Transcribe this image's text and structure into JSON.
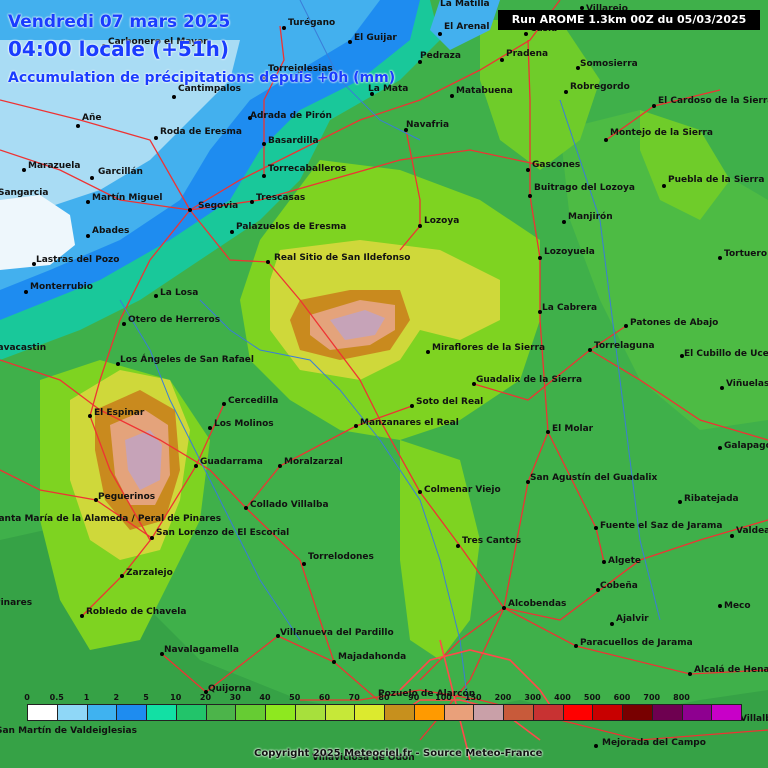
{
  "header": {
    "date_line": "Vendredi 07 mars 2025",
    "time_line": "04:00 locale (+51h)",
    "parameter_line": "Accumulation de précipitations depuis +0h (mm)",
    "run_info": "Run AROME 1.3km 00Z du 05/03/2025"
  },
  "colors": {
    "dry_white": "#ffffff",
    "very_light_blue": "#b9e3f6",
    "light_blue": "#43b0ee",
    "blue": "#1c72e8",
    "teal": "#1fd39a",
    "green": "#3fb04a",
    "lime": "#7ed321",
    "yellow": "#d6d936",
    "orange_brown": "#c98a1e",
    "salmon": "#e4a37b",
    "mauve": "#c6a3b8"
  },
  "scale": {
    "labels": [
      "0",
      "0.5",
      "1",
      "2",
      "5",
      "10",
      "20",
      "30",
      "40",
      "50",
      "60",
      "70",
      "80",
      "90",
      "100",
      "150",
      "200",
      "300",
      "400",
      "500",
      "600",
      "700",
      "800"
    ],
    "colors": [
      "#ffffff",
      "#8fd7f7",
      "#3fb2f0",
      "#1e8cf0",
      "#12e0a4",
      "#22c46a",
      "#4cb44a",
      "#66cc33",
      "#8ee81f",
      "#a7e03c",
      "#c6e838",
      "#dcea2e",
      "#c7901d",
      "#ff9a00",
      "#e9a07a",
      "#c9a0a8",
      "#c85a3a",
      "#c83232",
      "#ff0000",
      "#c80000",
      "#780000",
      "#6e0050",
      "#8e0090",
      "#c800c8"
    ]
  },
  "towns": [
    {
      "name": "Villarejo",
      "dot": [
        582,
        8
      ],
      "label": [
        586,
        4
      ]
    },
    {
      "name": "La Matilla",
      "dot": [
        0,
        0
      ],
      "label": [
        440,
        -1
      ]
    },
    {
      "name": "Turégano",
      "dot": [
        284,
        28
      ],
      "label": [
        288,
        18
      ]
    },
    {
      "name": "El Arenal",
      "dot": [
        440,
        34
      ],
      "label": [
        444,
        22
      ]
    },
    {
      "name": "Casla",
      "dot": [
        526,
        34
      ],
      "label": [
        530,
        24
      ]
    },
    {
      "name": "Cantimpalos",
      "dot": [
        174,
        97
      ],
      "label": [
        178,
        84
      ]
    },
    {
      "name": "Carbonero el Mayor",
      "dot": [
        104,
        46
      ],
      "label": [
        108,
        37
      ]
    },
    {
      "name": "El Guijar",
      "dot": [
        350,
        42
      ],
      "label": [
        354,
        33
      ]
    },
    {
      "name": "Pedraza",
      "dot": [
        420,
        62
      ],
      "label": [
        420,
        51
      ]
    },
    {
      "name": "Pradena",
      "dot": [
        502,
        60
      ],
      "label": [
        506,
        49
      ]
    },
    {
      "name": "Torreiglesias",
      "dot": [
        264,
        78
      ],
      "label": [
        268,
        64
      ]
    },
    {
      "name": "Somosierra",
      "dot": [
        578,
        68
      ],
      "label": [
        580,
        59
      ]
    },
    {
      "name": "La Mata",
      "dot": [
        372,
        94
      ],
      "label": [
        368,
        84
      ]
    },
    {
      "name": "Matabuena",
      "dot": [
        452,
        96
      ],
      "label": [
        456,
        86
      ]
    },
    {
      "name": "Robregordo",
      "dot": [
        566,
        92
      ],
      "label": [
        570,
        82
      ]
    },
    {
      "name": "El Cardoso de la Sierra",
      "dot": [
        654,
        106
      ],
      "label": [
        658,
        96
      ]
    },
    {
      "name": "Añe",
      "dot": [
        78,
        126
      ],
      "label": [
        82,
        113
      ]
    },
    {
      "name": "Adrada de Pirón",
      "dot": [
        250,
        118
      ],
      "label": [
        250,
        111
      ]
    },
    {
      "name": "Roda de Eresma",
      "dot": [
        156,
        138
      ],
      "label": [
        160,
        127
      ]
    },
    {
      "name": "Navafria",
      "dot": [
        406,
        130
      ],
      "label": [
        406,
        120
      ]
    },
    {
      "name": "Montejo de la Sierra",
      "dot": [
        606,
        140
      ],
      "label": [
        610,
        128
      ]
    },
    {
      "name": "Basardilla",
      "dot": [
        264,
        144
      ],
      "label": [
        268,
        136
      ]
    },
    {
      "name": "Marazuela",
      "dot": [
        24,
        170
      ],
      "label": [
        28,
        161
      ]
    },
    {
      "name": "Garcillán",
      "dot": [
        92,
        178
      ],
      "label": [
        98,
        167
      ]
    },
    {
      "name": "Torrecaballeros",
      "dot": [
        264,
        176
      ],
      "label": [
        268,
        164
      ]
    },
    {
      "name": "Gascones",
      "dot": [
        528,
        170
      ],
      "label": [
        532,
        160
      ]
    },
    {
      "name": "Puebla de la Sierra",
      "dot": [
        664,
        186
      ],
      "label": [
        668,
        175
      ]
    },
    {
      "name": "Sangarcia",
      "dot": [
        0,
        0
      ],
      "label": [
        -2,
        188
      ]
    },
    {
      "name": "Buitrago del Lozoya",
      "dot": [
        530,
        196
      ],
      "label": [
        534,
        183
      ]
    },
    {
      "name": "Martín Miguel",
      "dot": [
        88,
        202
      ],
      "label": [
        92,
        193
      ]
    },
    {
      "name": "Trescasas",
      "dot": [
        252,
        202
      ],
      "label": [
        256,
        193
      ]
    },
    {
      "name": "Segovia",
      "dot": [
        190,
        210
      ],
      "label": [
        198,
        201
      ]
    },
    {
      "name": "Manjirón",
      "dot": [
        564,
        222
      ],
      "label": [
        568,
        212
      ]
    },
    {
      "name": "Lozoya",
      "dot": [
        420,
        226
      ],
      "label": [
        424,
        216
      ]
    },
    {
      "name": "Palazuelos de Eresma",
      "dot": [
        232,
        232
      ],
      "label": [
        236,
        222
      ]
    },
    {
      "name": "Abades",
      "dot": [
        88,
        236
      ],
      "label": [
        92,
        226
      ]
    },
    {
      "name": "Tortuero",
      "dot": [
        720,
        258
      ],
      "label": [
        724,
        249
      ]
    },
    {
      "name": "Lozoyuela",
      "dot": [
        540,
        258
      ],
      "label": [
        544,
        247
      ]
    },
    {
      "name": "Real Sitio de San Ildefonso",
      "dot": [
        268,
        262
      ],
      "label": [
        274,
        253
      ]
    },
    {
      "name": "Lastras del Pozo",
      "dot": [
        34,
        264
      ],
      "label": [
        36,
        255
      ]
    },
    {
      "name": "Monterrubio",
      "dot": [
        26,
        292
      ],
      "label": [
        30,
        282
      ]
    },
    {
      "name": "La Losa",
      "dot": [
        156,
        296
      ],
      "label": [
        160,
        288
      ]
    },
    {
      "name": "La Cabrera",
      "dot": [
        540,
        312
      ],
      "label": [
        542,
        303
      ]
    },
    {
      "name": "Otero de Herreros",
      "dot": [
        124,
        324
      ],
      "label": [
        128,
        315
      ]
    },
    {
      "name": "Patones de Abajo",
      "dot": [
        626,
        326
      ],
      "label": [
        630,
        318
      ]
    },
    {
      "name": "Navacastin",
      "dot": [
        0,
        0
      ],
      "label": [
        -10,
        343
      ]
    },
    {
      "name": "Torrelaguna",
      "dot": [
        590,
        350
      ],
      "label": [
        594,
        341
      ]
    },
    {
      "name": "Miraflores de la Sierra",
      "dot": [
        428,
        352
      ],
      "label": [
        432,
        343
      ]
    },
    {
      "name": "El Cubillo de Uceda",
      "dot": [
        682,
        356
      ],
      "label": [
        684,
        349
      ]
    },
    {
      "name": "Los Ángeles de San Rafael",
      "dot": [
        118,
        364
      ],
      "label": [
        120,
        355
      ]
    },
    {
      "name": "Guadalix de la Sierra",
      "dot": [
        474,
        384
      ],
      "label": [
        476,
        375
      ]
    },
    {
      "name": "Viñuelas",
      "dot": [
        722,
        388
      ],
      "label": [
        726,
        379
      ]
    },
    {
      "name": "Cercedilla",
      "dot": [
        224,
        404
      ],
      "label": [
        228,
        396
      ]
    },
    {
      "name": "Soto del Real",
      "dot": [
        412,
        406
      ],
      "label": [
        416,
        397
      ]
    },
    {
      "name": "El Espinar",
      "dot": [
        90,
        416
      ],
      "label": [
        94,
        408
      ]
    },
    {
      "name": "Los Molinos",
      "dot": [
        210,
        428
      ],
      "label": [
        214,
        419
      ]
    },
    {
      "name": "Manzanares el Real",
      "dot": [
        356,
        426
      ],
      "label": [
        360,
        418
      ]
    },
    {
      "name": "El Molar",
      "dot": [
        548,
        432
      ],
      "label": [
        552,
        424
      ]
    },
    {
      "name": "Galapagos",
      "dot": [
        720,
        448
      ],
      "label": [
        724,
        441
      ]
    },
    {
      "name": "Guadarrama",
      "dot": [
        196,
        466
      ],
      "label": [
        200,
        457
      ]
    },
    {
      "name": "Moralzarzal",
      "dot": [
        280,
        466
      ],
      "label": [
        284,
        457
      ]
    },
    {
      "name": "San Agustín del Guadalix",
      "dot": [
        528,
        482
      ],
      "label": [
        530,
        473
      ]
    },
    {
      "name": "Colmenar Viejo",
      "dot": [
        420,
        492
      ],
      "label": [
        424,
        485
      ]
    },
    {
      "name": "Peguerinos",
      "dot": [
        96,
        500
      ],
      "label": [
        98,
        492
      ]
    },
    {
      "name": "Ribatejada",
      "dot": [
        680,
        502
      ],
      "label": [
        684,
        494
      ]
    },
    {
      "name": "Collado Villalba",
      "dot": [
        246,
        508
      ],
      "label": [
        250,
        500
      ]
    },
    {
      "name": "Santa María de la Alameda / Peral de Pinares",
      "dot": [
        0,
        0
      ],
      "label": [
        -8,
        514
      ]
    },
    {
      "name": "Fuente el Saz de Jarama",
      "dot": [
        596,
        528
      ],
      "label": [
        600,
        521
      ]
    },
    {
      "name": "Valdeavero",
      "dot": [
        732,
        536
      ],
      "label": [
        736,
        526
      ]
    },
    {
      "name": "San Lorenzo de El Escorial",
      "dot": [
        152,
        538
      ],
      "label": [
        156,
        528
      ]
    },
    {
      "name": "Tres Cantos",
      "dot": [
        458,
        546
      ],
      "label": [
        462,
        536
      ]
    },
    {
      "name": "Torrelodones",
      "dot": [
        304,
        564
      ],
      "label": [
        308,
        552
      ]
    },
    {
      "name": "Algete",
      "dot": [
        604,
        562
      ],
      "label": [
        608,
        556
      ]
    },
    {
      "name": "Zarzalejo",
      "dot": [
        122,
        576
      ],
      "label": [
        126,
        568
      ]
    },
    {
      "name": "Cobeña",
      "dot": [
        598,
        590
      ],
      "label": [
        600,
        581
      ]
    },
    {
      "name": "Pinares",
      "dot": [
        0,
        0
      ],
      "label": [
        -6,
        598
      ]
    },
    {
      "name": "Alcobendas",
      "dot": [
        504,
        608
      ],
      "label": [
        508,
        599
      ]
    },
    {
      "name": "Robledo de Chavela",
      "dot": [
        82,
        616
      ],
      "label": [
        86,
        607
      ]
    },
    {
      "name": "Meco",
      "dot": [
        720,
        606
      ],
      "label": [
        724,
        601
      ]
    },
    {
      "name": "Ajalvir",
      "dot": [
        612,
        624
      ],
      "label": [
        616,
        614
      ]
    },
    {
      "name": "Villanueva del Pardillo",
      "dot": [
        278,
        636
      ],
      "label": [
        280,
        628
      ]
    },
    {
      "name": "Paracuellos de Jarama",
      "dot": [
        576,
        646
      ],
      "label": [
        580,
        638
      ]
    },
    {
      "name": "Navalagamella",
      "dot": [
        162,
        654
      ],
      "label": [
        164,
        645
      ]
    },
    {
      "name": "Majadahonda",
      "dot": [
        334,
        662
      ],
      "label": [
        338,
        652
      ]
    },
    {
      "name": "Alcalá de Henares",
      "dot": [
        690,
        674
      ],
      "label": [
        694,
        665
      ]
    },
    {
      "name": "Quijorna",
      "dot": [
        206,
        692
      ],
      "label": [
        208,
        684
      ]
    },
    {
      "name": "Pozuelo de Alarcón",
      "dot": [
        0,
        0
      ],
      "label": [
        378,
        689
      ]
    },
    {
      "name": "San Martín de Valdeiglesias",
      "dot": [
        0,
        0
      ],
      "label": [
        -4,
        726
      ]
    },
    {
      "name": "Villalbilla",
      "dot": [
        0,
        0
      ],
      "label": [
        740,
        714
      ]
    },
    {
      "name": "Mejorada del Campo",
      "dot": [
        596,
        746
      ],
      "label": [
        602,
        738
      ]
    },
    {
      "name": "Villaviciosa de Odón",
      "dot": [
        0,
        0
      ],
      "label": [
        312,
        753
      ]
    }
  ],
  "copyright": "Copyright 2025 Meteociel.fr - Source Meteo-France"
}
